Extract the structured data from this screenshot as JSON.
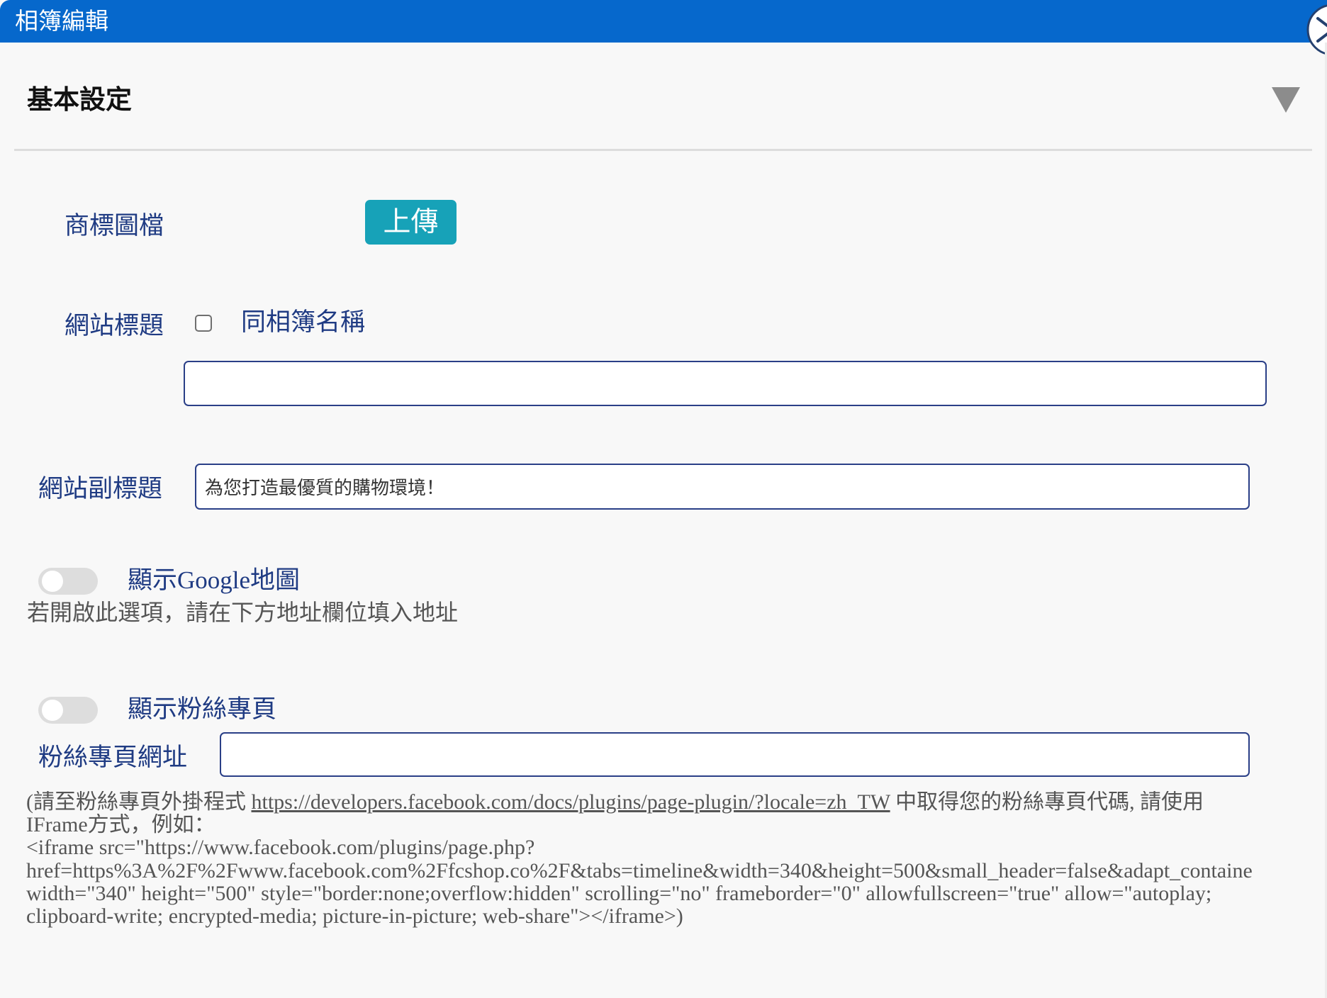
{
  "window": {
    "title": "相簿編輯"
  },
  "section": {
    "title": "基本設定"
  },
  "logo": {
    "label": "商標圖檔",
    "upload_label": "上傳"
  },
  "site_title": {
    "label": "網站標題",
    "same_as_album_label": "同相簿名稱",
    "same_as_album_checked": false,
    "value": ""
  },
  "site_subtitle": {
    "label": "網站副標題",
    "value": "為您打造最優質的購物環境！"
  },
  "google_map": {
    "label": "顯示Google地圖",
    "enabled": false,
    "hint": "若開啟此選項，請在下方地址欄位填入地址"
  },
  "fan_page": {
    "toggle_label": "顯示粉絲專頁",
    "enabled": false,
    "url_label": "粉絲專頁網址",
    "url_value": "",
    "help": {
      "prefix": "(請至粉絲專頁外掛程式 ",
      "link": "https://developers.facebook.com/docs/plugins/page-plugin/?locale=zh_TW",
      "suffix": " 中取得您的粉絲專頁代碼, 請使用",
      "lines": [
        "IFrame方式，例如：",
        "<iframe src=\"https://www.facebook.com/plugins/page.php?",
        "href=https%3A%2F%2Fwww.facebook.com%2Ffcshop.co%2F&tabs=timeline&width=340&height=500&small_header=false&adapt_containe",
        "width=\"340\" height=\"500\" style=\"border:none;overflow:hidden\" scrolling=\"no\" frameborder=\"0\" allowfullscreen=\"true\" allow=\"autoplay;",
        "clipboard-write; encrypted-media; picture-in-picture; web-share\"></iframe>)"
      ]
    }
  },
  "icons": {
    "close": "close-icon",
    "collapse": "triangle-down-icon"
  },
  "colors": {
    "title_bar": "#0668cc",
    "label": "#1f3b83",
    "upload_button": "#17a2b8",
    "hint_text": "#555555",
    "input_border": "#2a3f87"
  }
}
